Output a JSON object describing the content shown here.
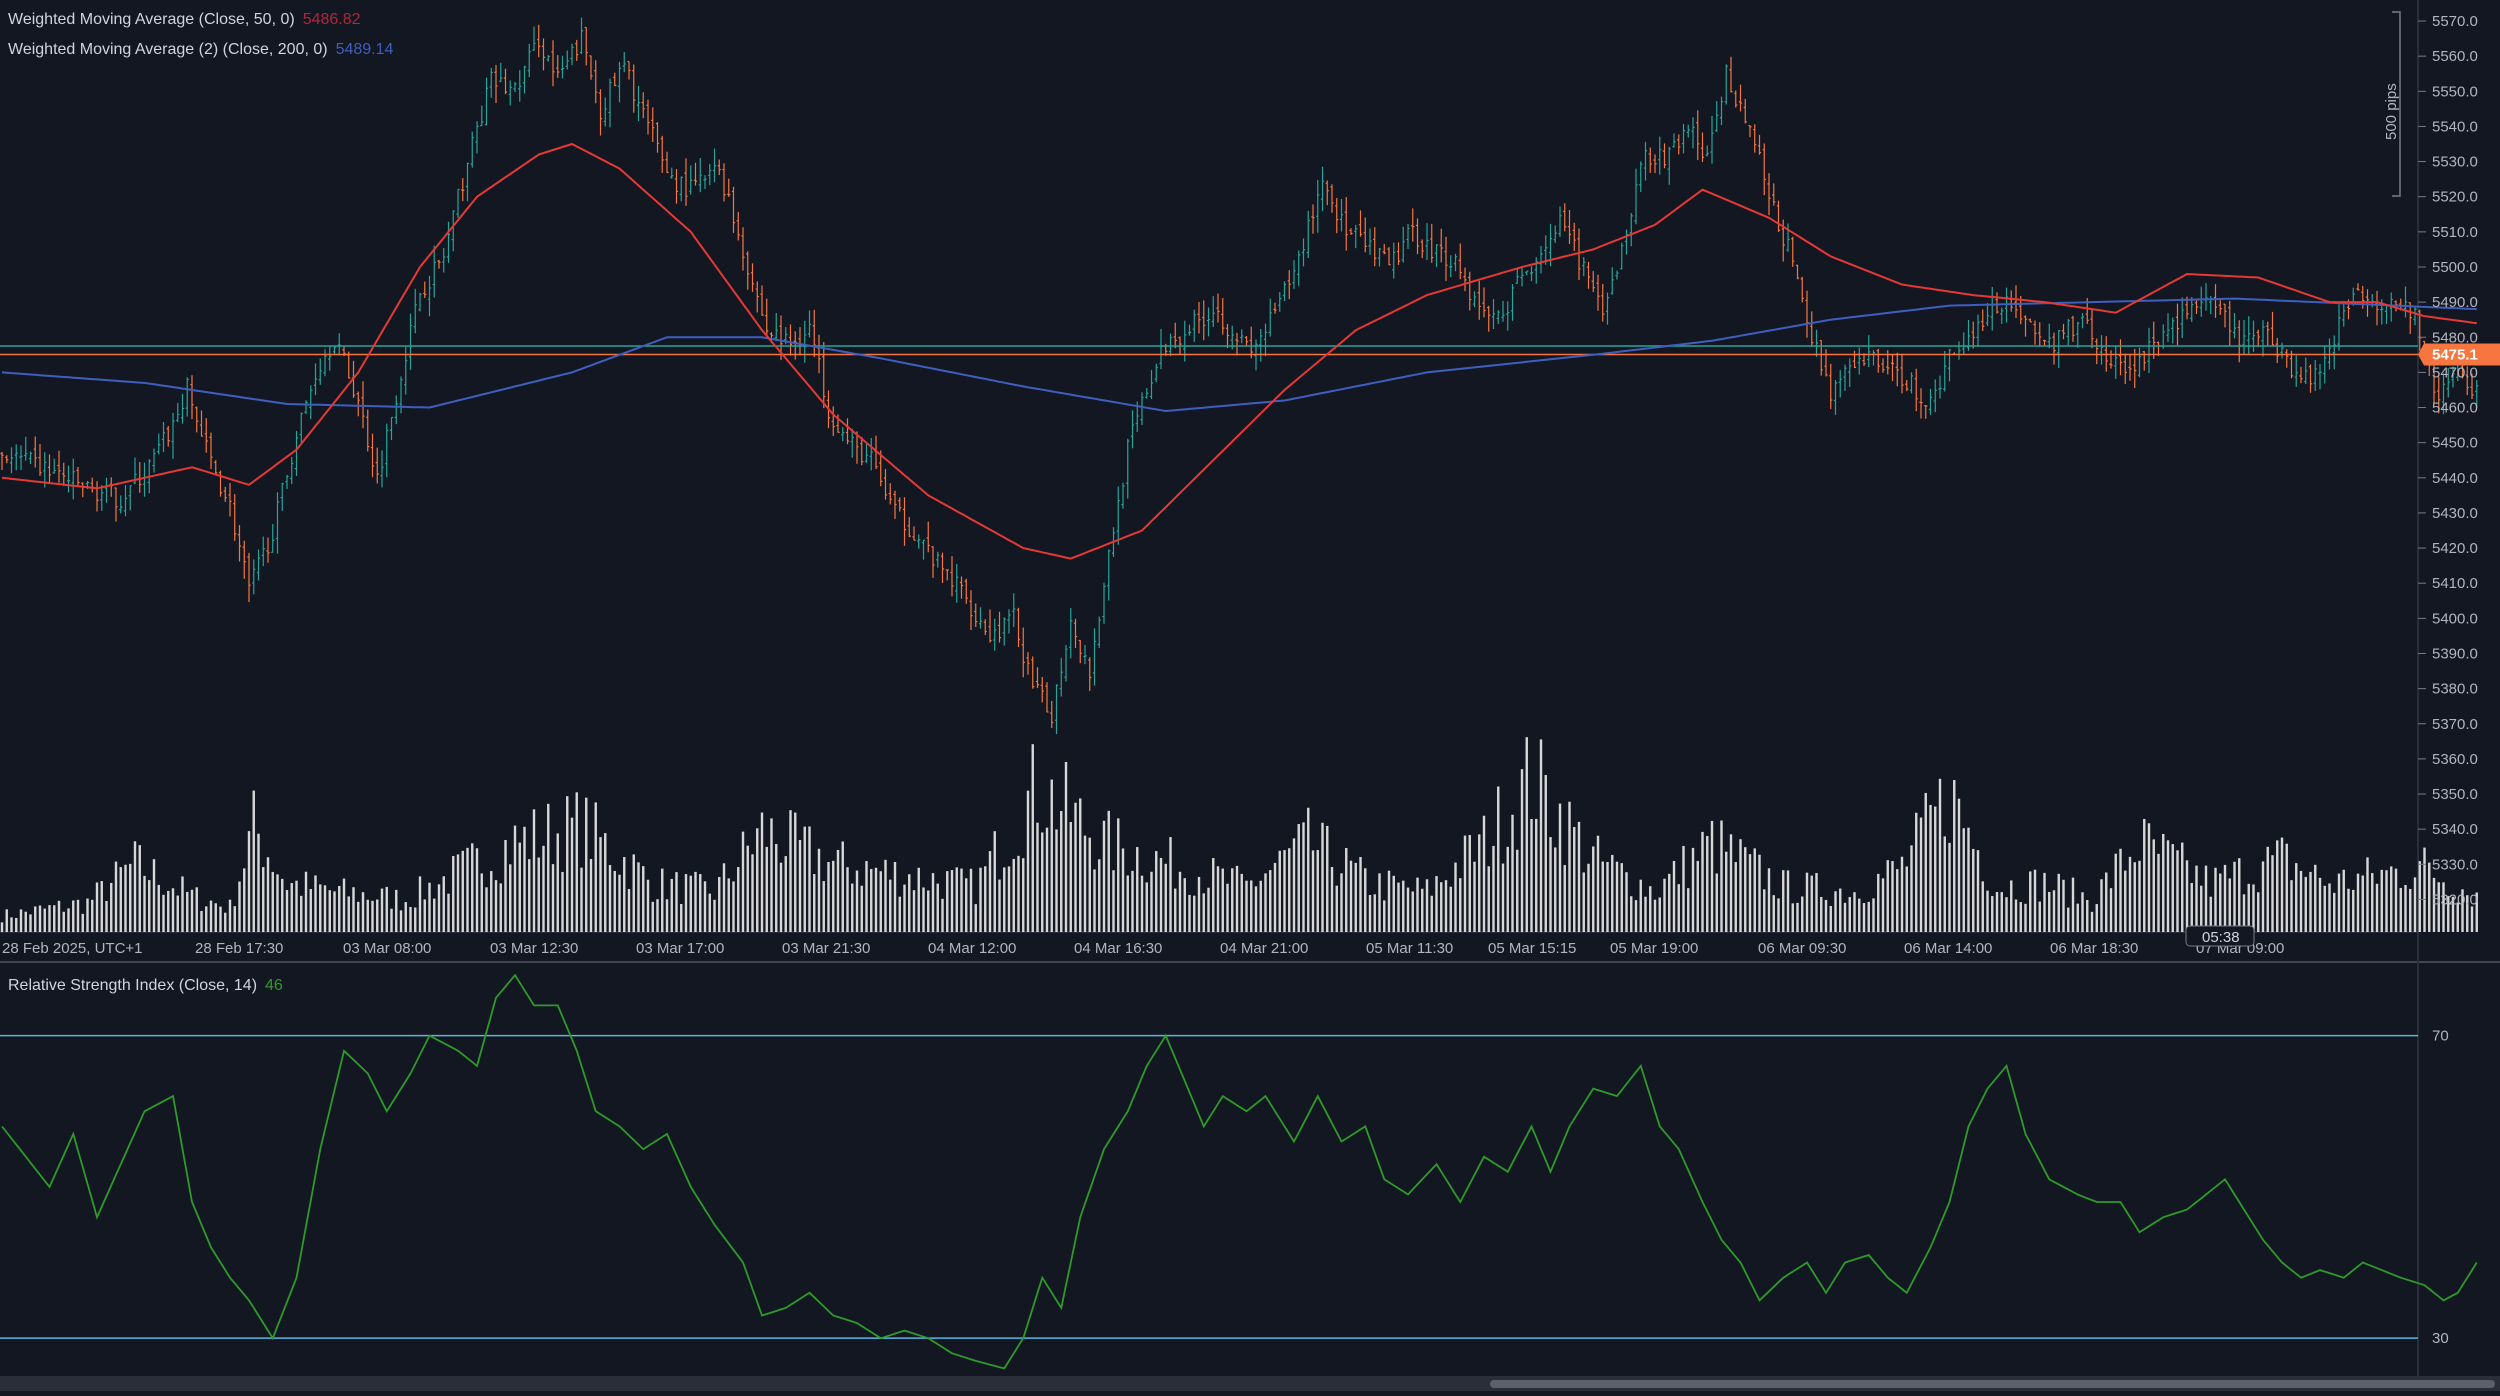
{
  "legend": {
    "wma50_label": "Weighted Moving Average (Close, 50, 0)",
    "wma50_value": "5486.82",
    "wma200_label": "Weighted Moving Average (2) (Close, 200, 0)",
    "wma200_value": "5489.14",
    "rsi_label": "Relative Strength Index (Close, 14)",
    "rsi_value": "46"
  },
  "colors": {
    "background": "#131722",
    "up_candle": "#26a69a",
    "down_candle": "#f7763f",
    "wma50": "#e53935",
    "wma200": "#3f5fbf",
    "rsi_line": "#2e9a2a",
    "rsi_bands": "#5ab4e5",
    "current_price_line": "#f7763f",
    "horizontal_line": "#26a69a",
    "volume_bar": "#e8e8e8",
    "axis_text": "#b2b5be"
  },
  "price_axis": {
    "ticks": [
      "5570.0",
      "5560.0",
      "5550.0",
      "5540.0",
      "5530.0",
      "5520.0",
      "5510.0",
      "5500.0",
      "5490.0",
      "5480.0",
      "5470.0",
      "5460.0",
      "5450.0",
      "5440.0",
      "5430.0",
      "5420.0",
      "5410.0",
      "5400.0",
      "5390.0",
      "5380.0",
      "5370.0",
      "5360.0",
      "5350.0",
      "5340.0",
      "5330.0",
      "5320.0"
    ],
    "current_price_label": "5475.1",
    "range_marker_label": "500 pips"
  },
  "time_axis": {
    "labels": [
      "28 Feb 2025, UTC+1",
      "28 Feb 17:30",
      "03 Mar 08:00",
      "03 Mar 12:30",
      "03 Mar 17:00",
      "03 Mar 21:30",
      "04 Mar 12:00",
      "04 Mar 16:30",
      "04 Mar 21:00",
      "05 Mar 11:30",
      "05 Mar 15:15",
      "05 Mar 19:00",
      "06 Mar 09:30",
      "06 Mar 14:00",
      "06 Mar 18:30",
      "07 Mar 09:00"
    ],
    "countdown": "05:38"
  },
  "rsi_axis": {
    "levels": [
      "70",
      "30"
    ]
  },
  "chart_data": [
    {
      "type": "candlestick",
      "title": "",
      "x_labels": [
        "28 Feb 2025, UTC+1",
        "28 Feb 17:30",
        "03 Mar 08:00",
        "03 Mar 12:30",
        "03 Mar 17:00",
        "03 Mar 21:30",
        "04 Mar 12:00",
        "04 Mar 16:30",
        "04 Mar 21:00",
        "05 Mar 11:30",
        "05 Mar 15:15",
        "05 Mar 19:00",
        "06 Mar 09:30",
        "06 Mar 14:00",
        "06 Mar 18:30",
        "07 Mar 09:00"
      ],
      "ylim": [
        5315,
        5572
      ],
      "close_path": [
        [
          0,
          5447
        ],
        [
          10,
          5442
        ],
        [
          18,
          5437
        ],
        [
          25,
          5434
        ],
        [
          31,
          5443
        ],
        [
          36,
          5455
        ],
        [
          39,
          5465
        ],
        [
          43,
          5448
        ],
        [
          48,
          5432
        ],
        [
          52,
          5408
        ],
        [
          57,
          5425
        ],
        [
          62,
          5452
        ],
        [
          66,
          5470
        ],
        [
          70,
          5480
        ],
        [
          75,
          5462
        ],
        [
          79,
          5440
        ],
        [
          84,
          5470
        ],
        [
          88,
          5493
        ],
        [
          93,
          5503
        ],
        [
          98,
          5530
        ],
        [
          103,
          5553
        ],
        [
          108,
          5550
        ],
        [
          113,
          5565
        ],
        [
          117,
          5553
        ],
        [
          122,
          5565
        ],
        [
          126,
          5545
        ],
        [
          131,
          5557
        ],
        [
          136,
          5540
        ],
        [
          141,
          5525
        ],
        [
          145,
          5522
        ],
        [
          151,
          5528
        ],
        [
          156,
          5505
        ],
        [
          161,
          5482
        ],
        [
          166,
          5478
        ],
        [
          170,
          5483
        ],
        [
          174,
          5460
        ],
        [
          178,
          5450
        ],
        [
          183,
          5445
        ],
        [
          188,
          5430
        ],
        [
          192,
          5425
        ],
        [
          197,
          5415
        ],
        [
          202,
          5408
        ],
        [
          208,
          5395
        ],
        [
          213,
          5400
        ],
        [
          217,
          5380
        ],
        [
          221,
          5373
        ],
        [
          225,
          5400
        ],
        [
          229,
          5385
        ],
        [
          233,
          5418
        ],
        [
          237,
          5448
        ],
        [
          241,
          5465
        ],
        [
          245,
          5478
        ],
        [
          250,
          5483
        ],
        [
          255,
          5488
        ],
        [
          259,
          5482
        ],
        [
          263,
          5475
        ],
        [
          268,
          5487
        ],
        [
          272,
          5498
        ],
        [
          278,
          5525
        ],
        [
          283,
          5510
        ],
        [
          288,
          5505
        ],
        [
          292,
          5500
        ],
        [
          297,
          5510
        ],
        [
          301,
          5505
        ],
        [
          306,
          5502
        ],
        [
          310,
          5490
        ],
        [
          315,
          5485
        ],
        [
          319,
          5495
        ],
        [
          324,
          5505
        ],
        [
          328,
          5512
        ],
        [
          333,
          5500
        ],
        [
          337,
          5485
        ],
        [
          342,
          5510
        ],
        [
          346,
          5533
        ],
        [
          350,
          5530
        ],
        [
          355,
          5540
        ],
        [
          359,
          5530
        ],
        [
          363,
          5555
        ],
        [
          368,
          5540
        ],
        [
          372,
          5520
        ],
        [
          376,
          5505
        ],
        [
          381,
          5480
        ],
        [
          385,
          5465
        ],
        [
          389,
          5470
        ],
        [
          394,
          5475
        ],
        [
          398,
          5470
        ],
        [
          402,
          5467
        ],
        [
          406,
          5460
        ],
        [
          410,
          5475
        ],
        [
          414,
          5480
        ],
        [
          418,
          5488
        ],
        [
          422,
          5491
        ],
        [
          426,
          5485
        ],
        [
          430,
          5478
        ],
        [
          434,
          5480
        ],
        [
          438,
          5487
        ],
        [
          442,
          5475
        ],
        [
          447,
          5470
        ],
        [
          451,
          5475
        ],
        [
          455,
          5480
        ],
        [
          459,
          5487
        ],
        [
          463,
          5490
        ],
        [
          468,
          5485
        ],
        [
          472,
          5478
        ],
        [
          476,
          5482
        ],
        [
          480,
          5476
        ],
        [
          484,
          5468
        ],
        [
          488,
          5471
        ],
        [
          492,
          5484
        ],
        [
          496,
          5494
        ],
        [
          500,
          5490
        ],
        [
          504,
          5492
        ],
        [
          508,
          5485
        ],
        [
          513,
          5462
        ],
        [
          517,
          5470
        ],
        [
          521,
          5465
        ]
      ],
      "wma50_path": [
        [
          0,
          5440
        ],
        [
          20,
          5437
        ],
        [
          40,
          5443
        ],
        [
          52,
          5438
        ],
        [
          62,
          5448
        ],
        [
          75,
          5470
        ],
        [
          88,
          5500
        ],
        [
          100,
          5520
        ],
        [
          113,
          5532
        ],
        [
          120,
          5535
        ],
        [
          130,
          5528
        ],
        [
          145,
          5510
        ],
        [
          160,
          5482
        ],
        [
          175,
          5458
        ],
        [
          195,
          5435
        ],
        [
          215,
          5420
        ],
        [
          225,
          5417
        ],
        [
          240,
          5425
        ],
        [
          255,
          5445
        ],
        [
          270,
          5465
        ],
        [
          285,
          5482
        ],
        [
          300,
          5492
        ],
        [
          320,
          5500
        ],
        [
          335,
          5505
        ],
        [
          348,
          5512
        ],
        [
          358,
          5522
        ],
        [
          372,
          5514
        ],
        [
          385,
          5503
        ],
        [
          400,
          5495
        ],
        [
          415,
          5492
        ],
        [
          430,
          5490
        ],
        [
          445,
          5487
        ],
        [
          460,
          5498
        ],
        [
          475,
          5497
        ],
        [
          490,
          5490
        ],
        [
          500,
          5490
        ],
        [
          510,
          5486
        ],
        [
          521,
          5484
        ]
      ],
      "wma200_path": [
        [
          0,
          5470
        ],
        [
          30,
          5467
        ],
        [
          60,
          5461
        ],
        [
          90,
          5460
        ],
        [
          120,
          5470
        ],
        [
          140,
          5480
        ],
        [
          160,
          5480
        ],
        [
          185,
          5474
        ],
        [
          215,
          5466
        ],
        [
          245,
          5459
        ],
        [
          270,
          5462
        ],
        [
          300,
          5470
        ],
        [
          335,
          5475
        ],
        [
          360,
          5479
        ],
        [
          385,
          5485
        ],
        [
          410,
          5489
        ],
        [
          440,
          5490
        ],
        [
          470,
          5491
        ],
        [
          521,
          5488
        ]
      ],
      "current_price": 5475.1,
      "horizontal_level": 5477.5,
      "volume_profile": [
        [
          0,
          0.1
        ],
        [
          18,
          0.18
        ],
        [
          28,
          0.42
        ],
        [
          40,
          0.22
        ],
        [
          48,
          0.15
        ],
        [
          53,
          0.65
        ],
        [
          60,
          0.3
        ],
        [
          70,
          0.25
        ],
        [
          85,
          0.2
        ],
        [
          95,
          0.35
        ],
        [
          108,
          0.55
        ],
        [
          122,
          0.65
        ],
        [
          137,
          0.3
        ],
        [
          150,
          0.25
        ],
        [
          160,
          0.62
        ],
        [
          175,
          0.42
        ],
        [
          190,
          0.35
        ],
        [
          205,
          0.28
        ],
        [
          218,
          0.9
        ],
        [
          232,
          0.55
        ],
        [
          248,
          0.4
        ],
        [
          262,
          0.28
        ],
        [
          275,
          0.55
        ],
        [
          288,
          0.3
        ],
        [
          300,
          0.25
        ],
        [
          312,
          0.55
        ],
        [
          322,
          0.95
        ],
        [
          335,
          0.45
        ],
        [
          348,
          0.25
        ],
        [
          360,
          0.55
        ],
        [
          375,
          0.28
        ],
        [
          390,
          0.25
        ],
        [
          400,
          0.4
        ],
        [
          410,
          0.85
        ],
        [
          420,
          0.28
        ],
        [
          430,
          0.3
        ],
        [
          440,
          0.2
        ],
        [
          450,
          0.55
        ],
        [
          465,
          0.3
        ],
        [
          480,
          0.45
        ],
        [
          490,
          0.3
        ],
        [
          510,
          0.4
        ],
        [
          521,
          0.22
        ]
      ]
    },
    {
      "type": "line",
      "title": "",
      "ylim": [
        25,
        80
      ],
      "bands": [
        70,
        30
      ],
      "rsi_path": [
        [
          0,
          58
        ],
        [
          5,
          54
        ],
        [
          10,
          50
        ],
        [
          15,
          57
        ],
        [
          20,
          46
        ],
        [
          25,
          53
        ],
        [
          30,
          60
        ],
        [
          36,
          62
        ],
        [
          40,
          48
        ],
        [
          44,
          42
        ],
        [
          48,
          38
        ],
        [
          52,
          35
        ],
        [
          57,
          30
        ],
        [
          62,
          38
        ],
        [
          67,
          55
        ],
        [
          72,
          68
        ],
        [
          77,
          65
        ],
        [
          81,
          60
        ],
        [
          86,
          65
        ],
        [
          90,
          70
        ],
        [
          96,
          68
        ],
        [
          100,
          66
        ],
        [
          104,
          75
        ],
        [
          108,
          78
        ],
        [
          112,
          74
        ],
        [
          117,
          74
        ],
        [
          121,
          68
        ],
        [
          125,
          60
        ],
        [
          130,
          58
        ],
        [
          135,
          55
        ],
        [
          140,
          57
        ],
        [
          145,
          50
        ],
        [
          150,
          45
        ],
        [
          156,
          40
        ],
        [
          160,
          33
        ],
        [
          165,
          34
        ],
        [
          170,
          36
        ],
        [
          175,
          33
        ],
        [
          180,
          32
        ],
        [
          185,
          30
        ],
        [
          190,
          31
        ],
        [
          195,
          30
        ],
        [
          200,
          28
        ],
        [
          205,
          27
        ],
        [
          211,
          26
        ],
        [
          215,
          30
        ],
        [
          219,
          38
        ],
        [
          223,
          34
        ],
        [
          227,
          46
        ],
        [
          232,
          55
        ],
        [
          237,
          60
        ],
        [
          241,
          66
        ],
        [
          245,
          70
        ],
        [
          249,
          64
        ],
        [
          253,
          58
        ],
        [
          257,
          62
        ],
        [
          262,
          60
        ],
        [
          266,
          62
        ],
        [
          272,
          56
        ],
        [
          277,
          62
        ],
        [
          282,
          56
        ],
        [
          287,
          58
        ],
        [
          291,
          51
        ],
        [
          296,
          49
        ],
        [
          302,
          53
        ],
        [
          307,
          48
        ],
        [
          312,
          54
        ],
        [
          317,
          52
        ],
        [
          322,
          58
        ],
        [
          326,
          52
        ],
        [
          330,
          58
        ],
        [
          335,
          63
        ],
        [
          340,
          62
        ],
        [
          345,
          66
        ],
        [
          349,
          58
        ],
        [
          353,
          55
        ],
        [
          358,
          48
        ],
        [
          362,
          43
        ],
        [
          366,
          40
        ],
        [
          370,
          35
        ],
        [
          375,
          38
        ],
        [
          380,
          40
        ],
        [
          384,
          36
        ],
        [
          388,
          40
        ],
        [
          393,
          41
        ],
        [
          397,
          38
        ],
        [
          401,
          36
        ],
        [
          406,
          42
        ],
        [
          410,
          48
        ],
        [
          414,
          58
        ],
        [
          418,
          63
        ],
        [
          422,
          66
        ],
        [
          426,
          57
        ],
        [
          431,
          51
        ],
        [
          437,
          49
        ],
        [
          441,
          48
        ],
        [
          446,
          48
        ],
        [
          450,
          44
        ],
        [
          455,
          46
        ],
        [
          460,
          47
        ],
        [
          464,
          49
        ],
        [
          468,
          51
        ],
        [
          472,
          47
        ],
        [
          476,
          43
        ],
        [
          480,
          40
        ],
        [
          484,
          38
        ],
        [
          488,
          39
        ],
        [
          493,
          38
        ],
        [
          497,
          40
        ],
        [
          501,
          39
        ],
        [
          505,
          38
        ],
        [
          510,
          37
        ],
        [
          514,
          35
        ],
        [
          517,
          36
        ],
        [
          521,
          40
        ]
      ]
    }
  ]
}
